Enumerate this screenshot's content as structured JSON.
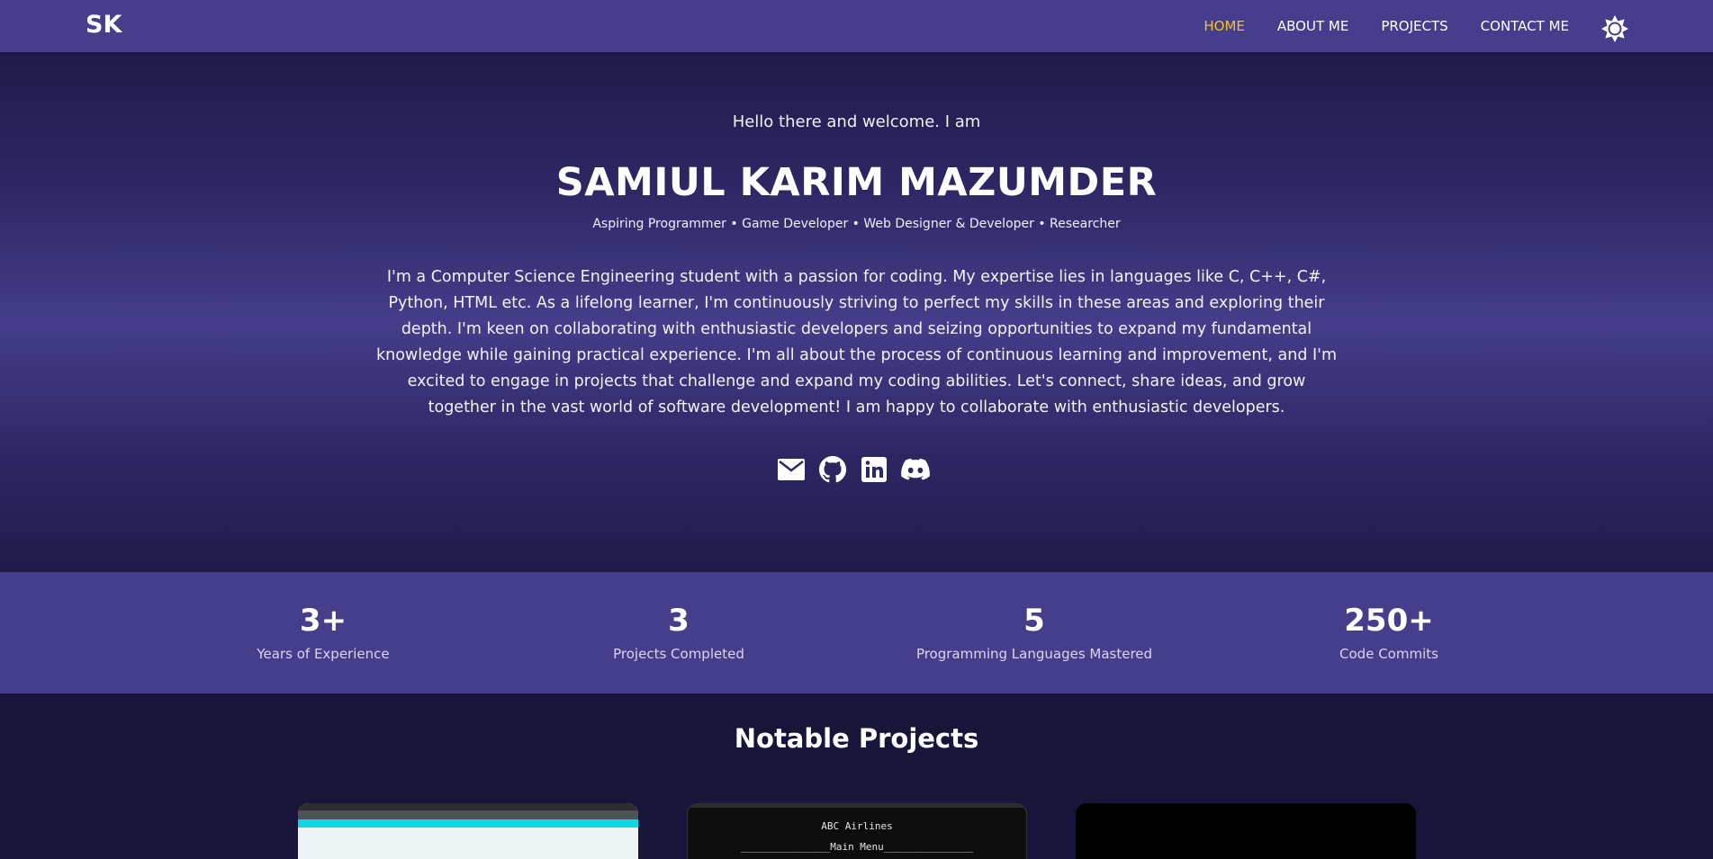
{
  "nav": {
    "logo": "SK",
    "links": [
      "HOME",
      "ABOUT ME",
      "PROJECTS",
      "CONTACT ME"
    ],
    "active_link": "HOME",
    "theme_icon": "sun-icon"
  },
  "hero": {
    "greeting": "Hello there and welcome. I am",
    "name": "SAMIUL KARIM MAZUMDER",
    "roles": "Aspiring Programmer • Game Developer • Web Designer & Developer • Researcher",
    "bio": "I'm a Computer Science Engineering student with a passion for coding. My expertise lies in languages like C, C++, C#, Python, HTML etc. As a lifelong learner, I'm continuously striving to perfect my skills in these areas and exploring their depth. I'm keen on collaborating with enthusiastic developers and seizing opportunities to expand my fundamental knowledge while gaining practical experience. I'm all about the process of continuous learning and improvement, and I'm excited to engage in projects that challenge and expand my coding abilities. Let's connect, share ideas, and grow together in the vast world of software development! I am happy to collaborate with enthusiastic developers.",
    "social_icons": [
      "email-icon",
      "github-icon",
      "linkedin-icon",
      "discord-icon"
    ]
  },
  "stats": [
    {
      "value": "3+",
      "label": "Years of Experience"
    },
    {
      "value": "3",
      "label": "Projects Completed"
    },
    {
      "value": "5",
      "label": "Programming Languages Mastered"
    },
    {
      "value": "250+",
      "label": "Code Commits"
    }
  ],
  "projects": {
    "title": "Notable Projects",
    "card2_line1": "ABC Airlines",
    "card2_line2": "_______________Main Menu_______________"
  },
  "colors": {
    "navbar": "#463e8c",
    "active_link": "#f1c232",
    "stats_band": "#453e8b",
    "page_bg": "#17153a"
  }
}
